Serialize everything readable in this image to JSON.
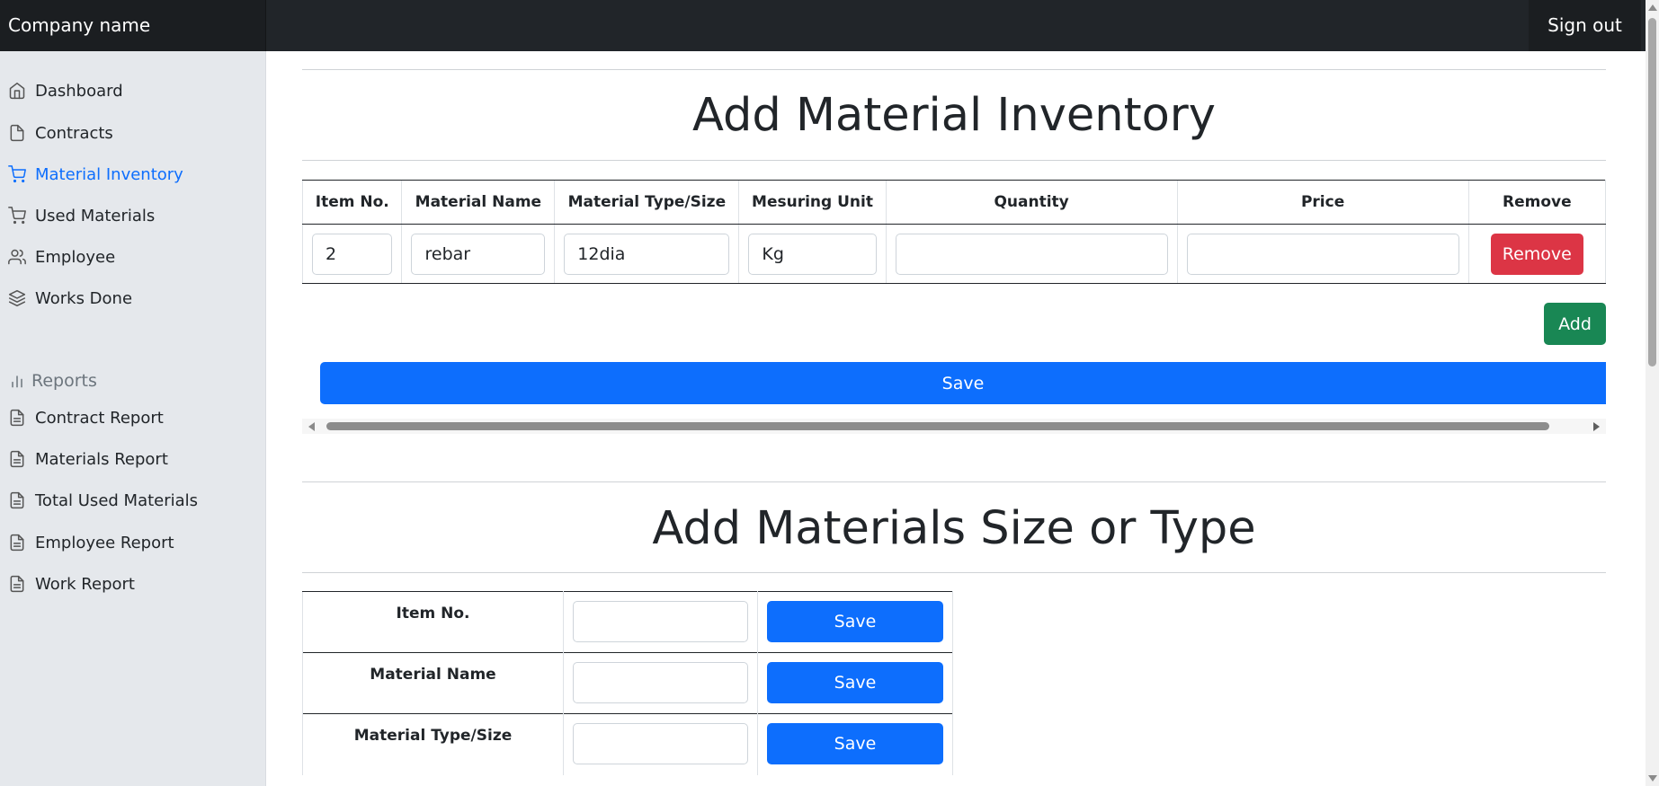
{
  "header": {
    "brand": "Company name",
    "signout": "Sign out"
  },
  "sidebar": {
    "items": [
      {
        "label": "Dashboard",
        "icon": "home-icon"
      },
      {
        "label": "Contracts",
        "icon": "file-icon"
      },
      {
        "label": "Material Inventory",
        "icon": "shopping-cart-icon",
        "active": true
      },
      {
        "label": "Used Materials",
        "icon": "shopping-cart-icon"
      },
      {
        "label": "Employee",
        "icon": "users-icon"
      },
      {
        "label": "Works Done",
        "icon": "layers-icon"
      }
    ],
    "reports_heading": "Reports",
    "reports": [
      {
        "label": "Contract Report",
        "icon": "file-text-icon"
      },
      {
        "label": "Materials Report",
        "icon": "file-text-icon"
      },
      {
        "label": "Total Used Materials",
        "icon": "file-text-icon"
      },
      {
        "label": "Employee Report",
        "icon": "file-text-icon"
      },
      {
        "label": "Work Report",
        "icon": "file-text-icon"
      }
    ]
  },
  "inventory": {
    "title": "Add Material Inventory",
    "columns": [
      "Item No.",
      "Material Name",
      "Material Type/Size",
      "Mesuring Unit",
      "Quantity",
      "Price",
      "Remove"
    ],
    "row": {
      "item_no": "2",
      "material_name": "rebar",
      "material_type": "12dia",
      "unit": "Kg",
      "quantity": "",
      "price": ""
    },
    "remove_label": "Remove",
    "add_label": "Add",
    "save_label": "Save"
  },
  "sizes": {
    "title": "Add Materials Size or Type",
    "rows": [
      {
        "label": "Item No.",
        "value": "",
        "button": "Save"
      },
      {
        "label": "Material Name",
        "value": "",
        "button": "Save"
      },
      {
        "label": "Material Type/Size",
        "value": "",
        "button": "Save"
      }
    ]
  },
  "colors": {
    "accent": "#0d6efd",
    "danger": "#dc3545",
    "success": "#198754",
    "dark": "#212529"
  }
}
